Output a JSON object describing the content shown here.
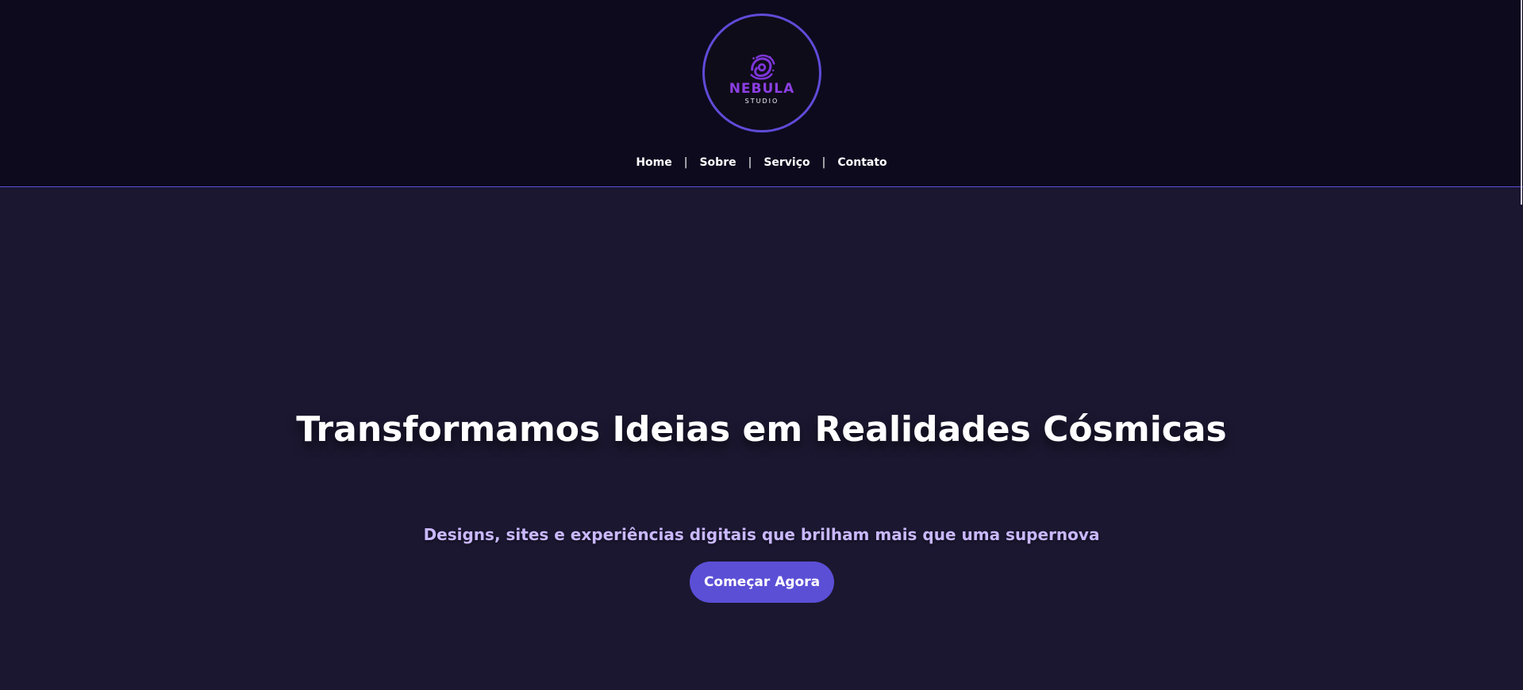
{
  "branding": {
    "logo_title": "NEBULA",
    "logo_subtitle": "STUDIO"
  },
  "navigation": {
    "items": [
      {
        "label": "Home"
      },
      {
        "label": "Sobre"
      },
      {
        "label": "Serviço"
      },
      {
        "label": "Contato"
      }
    ],
    "separator": "|"
  },
  "hero": {
    "title": "Transformamos Ideias em Realidades Cósmicas",
    "subtitle": "Designs, sites e experiências digitais que brilham mais que uma supernova",
    "button_label": "Começar Agora"
  },
  "colors": {
    "header_background": "#0d0a1e",
    "hero_background": "#1b1730",
    "accent": "#5b4fd6",
    "logo_text": "#8b3fe2",
    "subtitle_text": "#c9b8ff"
  },
  "icons": {
    "logo_mark": "spiral-galaxy-icon"
  }
}
